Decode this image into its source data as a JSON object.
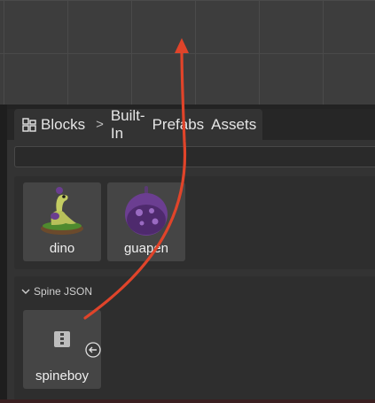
{
  "tabs": {
    "blocks_label": "Blocks",
    "separator": ">",
    "builtin_label": "Built-In",
    "prefabs_label": "Prefabs",
    "assets_label": "Assets"
  },
  "search": {
    "value": "",
    "placeholder": ""
  },
  "blocks": [
    {
      "label": "dino",
      "icon": "dino-icon"
    },
    {
      "label": "guapen",
      "icon": "guapen-icon"
    }
  ],
  "section": {
    "title": "Spine JSON",
    "items": [
      {
        "label": "spineboy",
        "icon": "spine-file-icon"
      }
    ]
  },
  "colors": {
    "arrow": "#e0442a",
    "panel": "#333333",
    "card": "#454545"
  }
}
